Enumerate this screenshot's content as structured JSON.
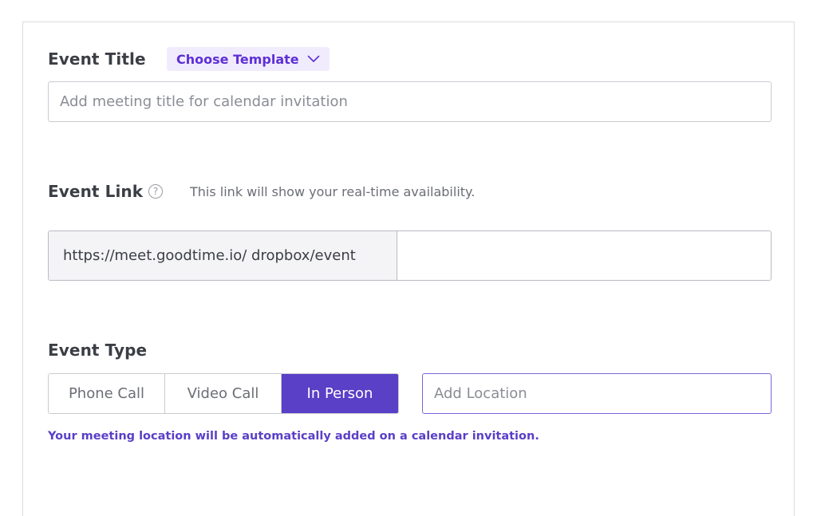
{
  "event_title": {
    "label": "Event Title",
    "template_button": "Choose Template",
    "input_placeholder": "Add meeting title for calendar invitation",
    "input_value": ""
  },
  "event_link": {
    "label": "Event Link",
    "help_icon": "question-circle-icon",
    "hint": "This link will show your real-time availability.",
    "prefix": "https://meet.goodtime.io/ dropbox/event",
    "slug_value": ""
  },
  "event_type": {
    "label": "Event Type",
    "options": [
      "Phone Call",
      "Video Call",
      "In Person"
    ],
    "selected": "In Person",
    "location_placeholder": "Add Location",
    "location_value": "",
    "note": "Your meeting location will be automatically added on a calendar invitation."
  },
  "colors": {
    "accent": "#5a3fc7",
    "template_bg": "#f1ecfd",
    "template_text": "#5e2fd6"
  }
}
